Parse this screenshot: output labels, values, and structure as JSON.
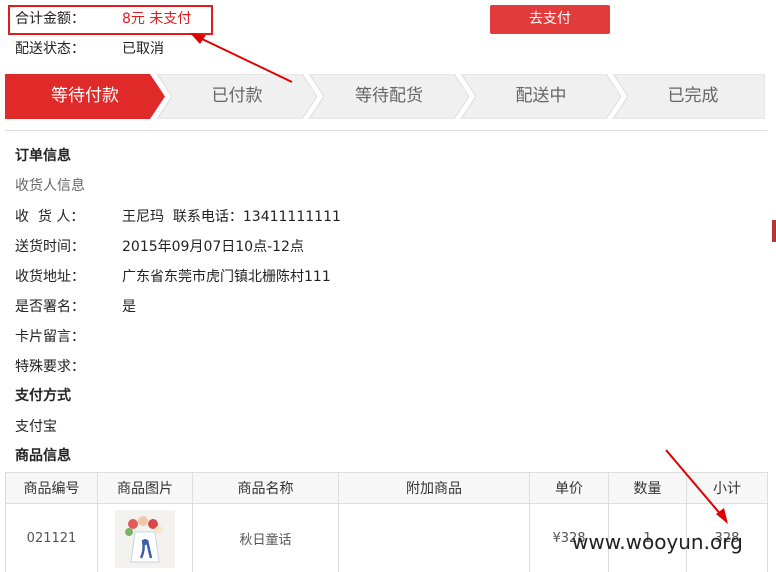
{
  "order_summary": {
    "total_label": "合计金额：",
    "total_value": "8元  未支付",
    "status_label": "配送状态：",
    "status_value": "已取消",
    "pay_button": "去支付"
  },
  "progress": {
    "steps": [
      "等待付款",
      "已付款",
      "等待配货",
      "配送中",
      "已完成"
    ],
    "active_index": 0
  },
  "order_info": {
    "title": "订单信息",
    "receiver_section": "收货人信息",
    "fields": [
      {
        "label": "收  货 人：",
        "value": "王尼玛  联系电话：13411111111"
      },
      {
        "label": "送货时间：",
        "value": "2015年09月07日10点-12点"
      },
      {
        "label": "收货地址：",
        "value": "广东省东莞市虎门镇北栅陈村111"
      },
      {
        "label": "是否署名：",
        "value": "是"
      },
      {
        "label": "卡片留言：",
        "value": ""
      },
      {
        "label": "特殊要求：",
        "value": ""
      }
    ],
    "payment_title": "支付方式",
    "payment_value": "支付宝",
    "goods_title": "商品信息"
  },
  "table": {
    "headers": [
      "商品编号",
      "商品图片",
      "商品名称",
      "附加商品",
      "单价",
      "数量",
      "小计"
    ],
    "rows": [
      {
        "id": "021121",
        "name": "秋日童话",
        "addon": "",
        "price": "¥328",
        "qty": "1",
        "subtotal": "328"
      }
    ]
  },
  "watermark": "www.wooyun.org",
  "colors": {
    "accent": "#e21c1c",
    "button": "#e23b3b",
    "step_active": "#e02a2a",
    "step_inactive": "#f0f0f0"
  }
}
